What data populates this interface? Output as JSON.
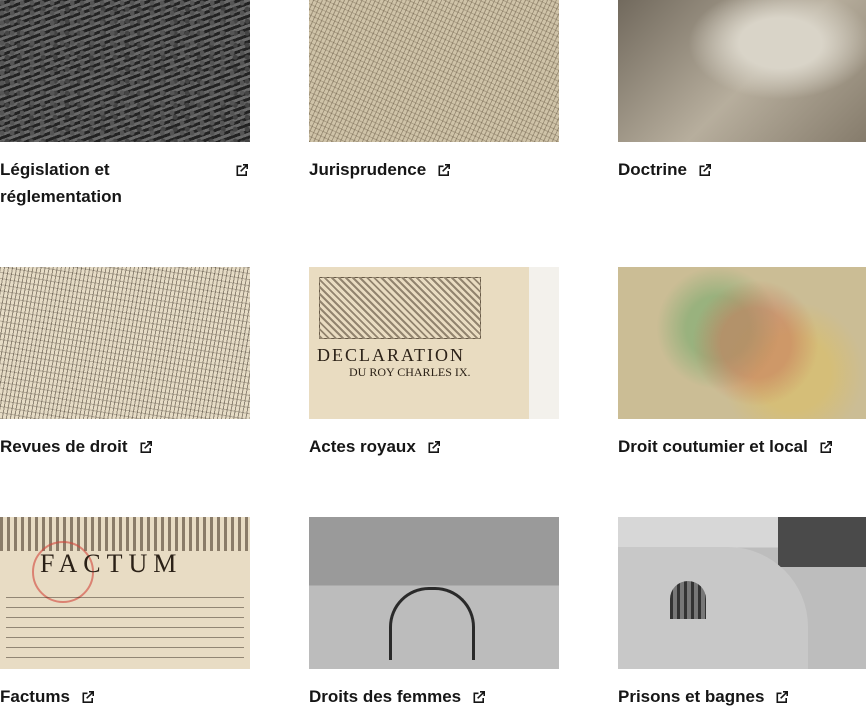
{
  "cards": [
    {
      "title": "Législation et réglementation",
      "icon": "external-link-icon"
    },
    {
      "title": "Jurisprudence",
      "icon": "external-link-icon"
    },
    {
      "title": "Doctrine",
      "icon": "external-link-icon"
    },
    {
      "title": "Revues de droit",
      "icon": "external-link-icon"
    },
    {
      "title": "Actes royaux",
      "icon": "external-link-icon"
    },
    {
      "title": "Droit coutumier et local",
      "icon": "external-link-icon"
    },
    {
      "title": "Factums",
      "icon": "external-link-icon"
    },
    {
      "title": "Droits des femmes",
      "icon": "external-link-icon"
    },
    {
      "title": "Prisons et bagnes",
      "icon": "external-link-icon"
    }
  ],
  "thumbnails": {
    "declaration_text": "DECLARATION",
    "declaration_sub": "DU ROY CHARLES IX.",
    "factum_text": "FACTUM"
  },
  "colors": {
    "text": "#161616",
    "background": "#ffffff"
  }
}
